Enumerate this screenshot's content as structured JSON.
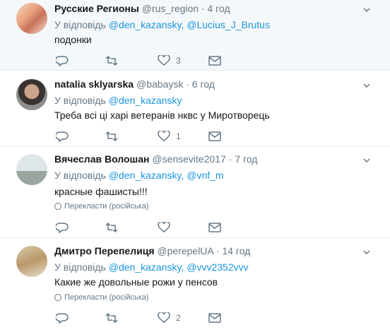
{
  "reply_prefix": "У відповідь",
  "tweets": [
    {
      "name": "Русские Регионы",
      "handle": "@rus_region",
      "time": "4 год",
      "mentions": [
        "@den_kazansky,",
        "@Lucius_J_Brutus"
      ],
      "text": "подонки",
      "translate": "",
      "reply_count": "",
      "retweet_count": "",
      "like_count": "3"
    },
    {
      "name": "natalia sklyarska",
      "handle": "@babaysk",
      "time": "6 год",
      "mentions": [
        "@den_kazansky"
      ],
      "text": "Треба всі ці харі ветеранів нквс у Миротворець",
      "translate": "",
      "reply_count": "",
      "retweet_count": "",
      "like_count": "1"
    },
    {
      "name": "Вячеслав Волошан",
      "handle": "@sensevite2017",
      "time": "7 год",
      "mentions": [
        "@den_kazansky,",
        "@vnf_m"
      ],
      "text": "красные фашисты!!!",
      "translate": "Перекласти (російська)",
      "reply_count": "",
      "retweet_count": "",
      "like_count": ""
    },
    {
      "name": "Дмитро Перепелиця",
      "handle": "@perepelUA",
      "time": "14 год",
      "mentions": [
        "@den_kazansky,",
        "@vvv2352vvv"
      ],
      "text": "Какие же довольные рожи у пенсов",
      "translate": "Перекласти (російська)",
      "reply_count": "",
      "retweet_count": "",
      "like_count": "2"
    }
  ]
}
